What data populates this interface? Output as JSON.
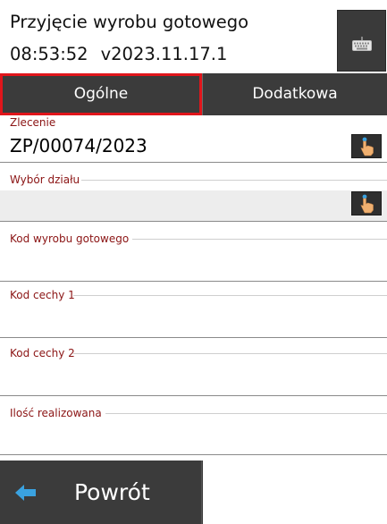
{
  "header": {
    "title": "Przyjęcie wyrobu gotowego",
    "time": "08:53:52",
    "version": "v2023.11.17.1",
    "keyboard_icon": "keyboard-icon"
  },
  "tabs": [
    {
      "label": "Ogólne",
      "selected": true
    },
    {
      "label": "Dodatkowa",
      "selected": false
    }
  ],
  "fields": {
    "zlecenie": {
      "label": "Zlecenie",
      "value": "ZP/00074/2023"
    },
    "wybor_dzialu": {
      "label": "Wybór działu",
      "value": ""
    },
    "kod_wyrobu": {
      "label": "Kod wyrobu gotowego",
      "value": ""
    },
    "kod_cechy_1": {
      "label": "Kod cechy 1",
      "value": ""
    },
    "kod_cechy_2": {
      "label": "Kod cechy 2",
      "value": ""
    },
    "ilosc": {
      "label": "Ilość realizowana",
      "value": ""
    }
  },
  "footer": {
    "back_label": "Powrót"
  },
  "colors": {
    "accent_red": "#e0151b",
    "label_red": "#8b1414",
    "dark_bg": "#3b3b3b",
    "arrow_blue": "#3aa2e0"
  }
}
